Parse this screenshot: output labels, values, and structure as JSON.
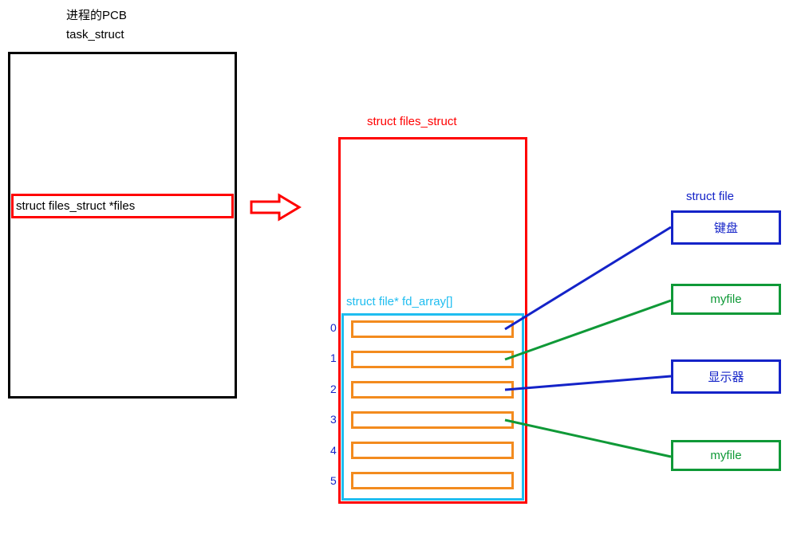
{
  "header": {
    "title1": "进程的PCB",
    "title2": "task_struct"
  },
  "pcb": {
    "member": "struct files_struct *files"
  },
  "files_struct": {
    "label": "struct files_struct",
    "fd_array_label": "struct file* fd_array[]",
    "indices": [
      "0",
      "1",
      "2",
      "3",
      "4",
      "5"
    ]
  },
  "struct_file_header": "struct file",
  "files": [
    {
      "label": "键盘",
      "color": "blue"
    },
    {
      "label": "myfile",
      "color": "green"
    },
    {
      "label": "显示器",
      "color": "blue"
    },
    {
      "label": "myfile",
      "color": "green"
    }
  ],
  "colors": {
    "red": "#ff0000",
    "blue": "#1423c8",
    "cyan": "#1fbdf0",
    "orange": "#f38b1e",
    "green": "#0f9937",
    "black": "#000000"
  }
}
